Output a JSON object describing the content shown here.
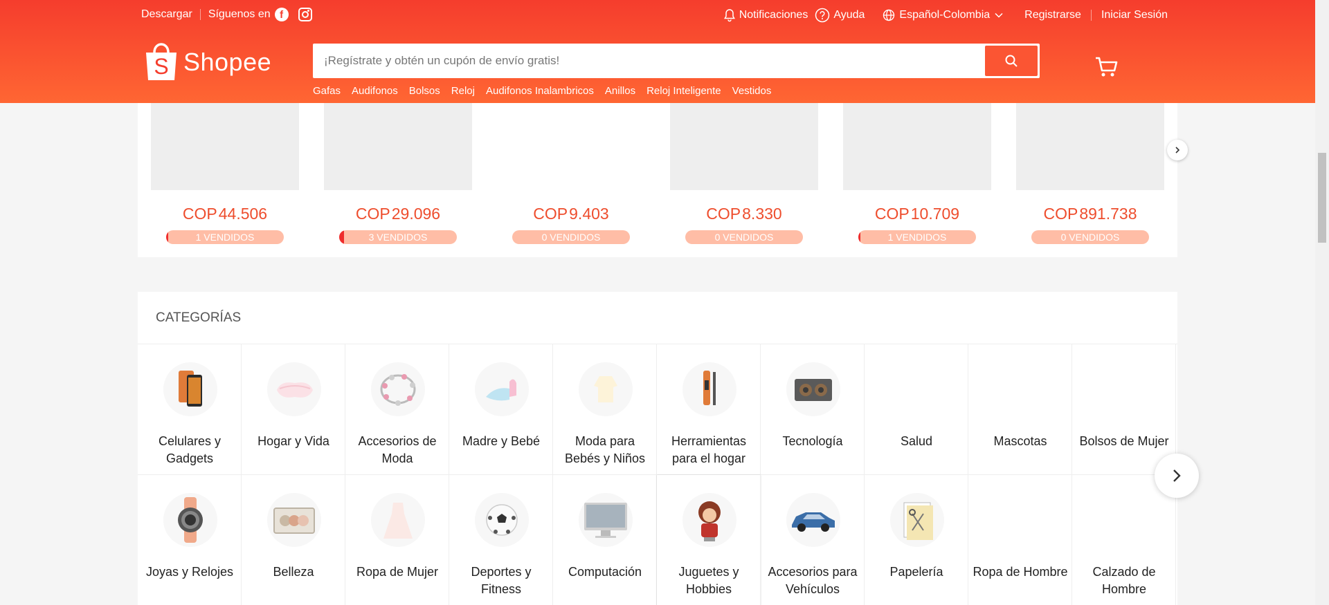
{
  "topbar": {
    "download": "Descargar",
    "follow": "Síguenos en",
    "notifications": "Notificaciones",
    "help": "Ayuda",
    "language": "Español-Colombia",
    "register": "Registrarse",
    "login": "Iniciar Sesión"
  },
  "header": {
    "logo": "Shopee",
    "search_placeholder": "¡Regístrate y obtén un cupón de envío gratis!",
    "keywords": [
      "Gafas",
      "Audifonos",
      "Bolsos",
      "Reloj",
      "Audifonos Inalambricos",
      "Anillos",
      "Reloj Inteligente",
      "Vestidos"
    ]
  },
  "products": [
    {
      "currency": "COP",
      "price": "44.506",
      "sold": "1 VENDIDOS",
      "sold_fraction": 0.02
    },
    {
      "currency": "COP",
      "price": "29.096",
      "sold": "3 VENDIDOS",
      "sold_fraction": 0.04
    },
    {
      "currency": "COP",
      "price": "9.403",
      "sold": "0 VENDIDOS",
      "sold_fraction": 0
    },
    {
      "currency": "COP",
      "price": "8.330",
      "sold": "0 VENDIDOS",
      "sold_fraction": 0
    },
    {
      "currency": "COP",
      "price": "10.709",
      "sold": "1 VENDIDOS",
      "sold_fraction": 0.02
    },
    {
      "currency": "COP",
      "price": "891.738",
      "sold": "0 VENDIDOS",
      "sold_fraction": 0
    }
  ],
  "categories": {
    "title": "CATEGORÍAS",
    "row1": [
      {
        "label": "Celulares y Gadgets",
        "icon": "phone-icon"
      },
      {
        "label": "Hogar y Vida",
        "icon": "pillow-icon"
      },
      {
        "label": "Accesorios de Moda",
        "icon": "bracelet-icon"
      },
      {
        "label": "Madre y Bebé",
        "icon": "baby-bottle-icon"
      },
      {
        "label": "Moda para Bebés y Niños",
        "icon": "baby-clothes-icon"
      },
      {
        "label": "Herramientas para el hogar",
        "icon": "tester-icon"
      },
      {
        "label": "Tecnología",
        "icon": "speaker-icon"
      },
      {
        "label": "Salud",
        "icon": ""
      },
      {
        "label": "Mascotas",
        "icon": ""
      },
      {
        "label": "Bolsos de Mujer",
        "icon": ""
      }
    ],
    "row2": [
      {
        "label": "Joyas y Relojes",
        "icon": "watch-icon"
      },
      {
        "label": "Belleza",
        "icon": "makeup-palette-icon"
      },
      {
        "label": "Ropa de Mujer",
        "icon": "dress-icon"
      },
      {
        "label": "Deportes y Fitness",
        "icon": "soccer-ball-icon"
      },
      {
        "label": "Computación",
        "icon": "monitor-icon"
      },
      {
        "label": "Juguetes y Hobbies",
        "icon": "figure-icon"
      },
      {
        "label": "Accesorios para Vehículos",
        "icon": "car-icon"
      },
      {
        "label": "Papelería",
        "icon": "notebook-icon"
      },
      {
        "label": "Ropa de Hombre",
        "icon": ""
      },
      {
        "label": "Calzado de Hombre",
        "icon": ""
      }
    ]
  },
  "colors": {
    "brand": "#ee4d2d",
    "sold_bg": "#ffbda6"
  }
}
